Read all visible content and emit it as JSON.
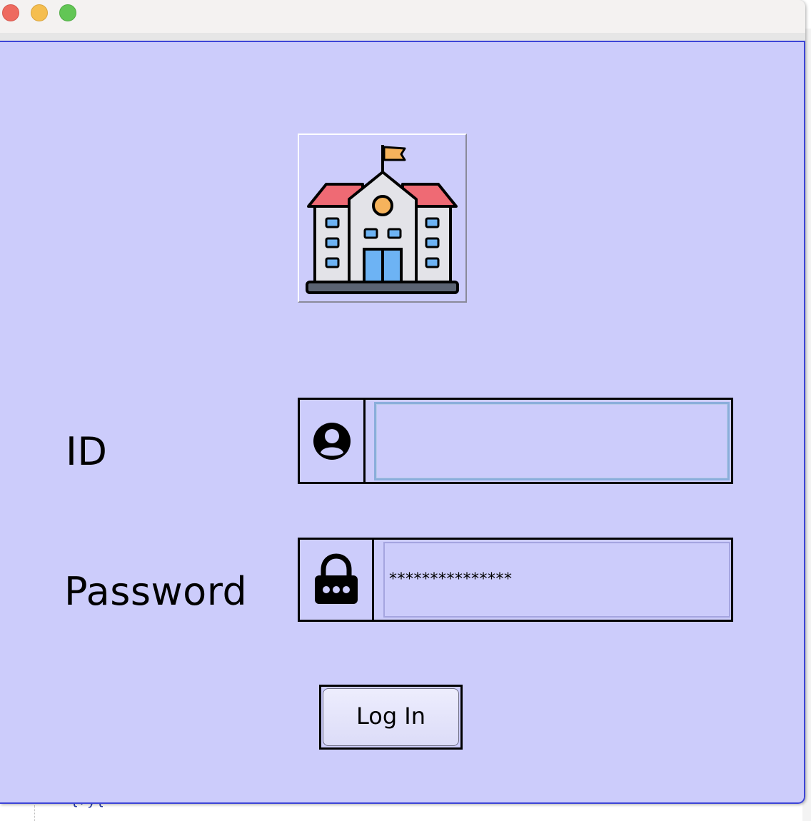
{
  "window": {
    "buttons": [
      "close",
      "minimize",
      "zoom"
    ]
  },
  "background": {
    "code_fragment": "{ry{"
  },
  "logo": {
    "icon": "school-building-icon"
  },
  "form": {
    "id_label": "ID",
    "id_icon": "user-account-icon",
    "id_value": "",
    "password_label": "Password",
    "password_icon": "padlock-icon",
    "password_value": "***************"
  },
  "login_button": {
    "label": "Log In"
  },
  "colors": {
    "panel_background": "#ccccfb",
    "window_border": "#3d45d6",
    "field_focus": "#8aaedb"
  }
}
